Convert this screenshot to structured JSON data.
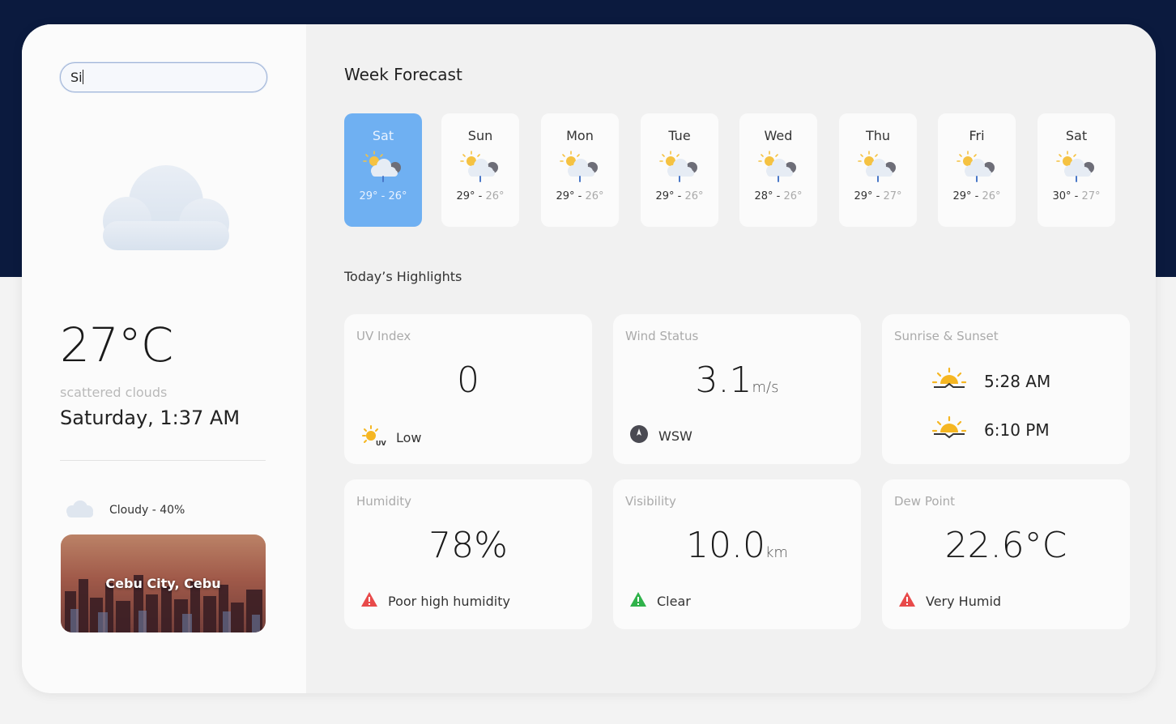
{
  "search": {
    "value": "Si"
  },
  "current": {
    "temperature": "27°C",
    "description": "scattered clouds",
    "datetime": "Saturday, 1:37 AM",
    "cloud_text": "Cloudy - 40%",
    "city": "Cebu City, Cebu"
  },
  "week": {
    "title": "Week Forecast",
    "days": [
      {
        "name": "Sat",
        "hi": "29°",
        "lo": "26°"
      },
      {
        "name": "Sun",
        "hi": "29°",
        "lo": "26°"
      },
      {
        "name": "Mon",
        "hi": "29°",
        "lo": "26°"
      },
      {
        "name": "Tue",
        "hi": "29°",
        "lo": "26°"
      },
      {
        "name": "Wed",
        "hi": "28°",
        "lo": "26°"
      },
      {
        "name": "Thu",
        "hi": "29°",
        "lo": "27°"
      },
      {
        "name": "Fri",
        "hi": "29°",
        "lo": "26°"
      },
      {
        "name": "Sat",
        "hi": "30°",
        "lo": "27°"
      }
    ],
    "active_index": 0
  },
  "highlights": {
    "title": "Today’s Highlights",
    "uv": {
      "label": "UV Index",
      "value": "0",
      "status": "Low"
    },
    "wind": {
      "label": "Wind Status",
      "value": "3.1",
      "unit": "m/s",
      "direction": "WSW"
    },
    "sun": {
      "label": "Sunrise & Sunset",
      "sunrise": "5:28 AM",
      "sunset": "6:10 PM"
    },
    "humidity": {
      "label": "Humidity",
      "value": "78%",
      "status": "Poor high humidity"
    },
    "visibility": {
      "label": "Visibility",
      "value": "10.0",
      "unit": "km",
      "status": "Clear"
    },
    "dew": {
      "label": "Dew Point",
      "value": "22.6°C",
      "status": "Very Humid"
    }
  },
  "colors": {
    "accent": "#6fb0f2",
    "navy": "#0b1a3e",
    "warn": "#e84a4a",
    "ok": "#2fb24a",
    "sun": "#f5b622"
  }
}
